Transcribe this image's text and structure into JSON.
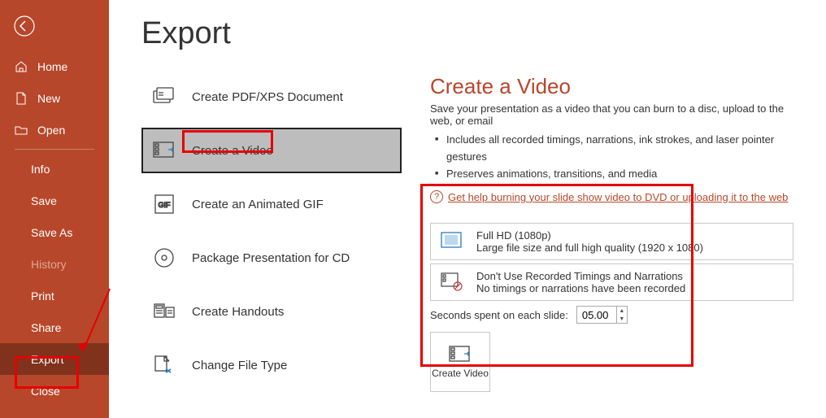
{
  "sidebar": {
    "home": "Home",
    "new": "New",
    "open": "Open",
    "info": "Info",
    "save": "Save",
    "save_as": "Save As",
    "history": "History",
    "print": "Print",
    "share": "Share",
    "export": "Export",
    "close": "Close"
  },
  "page": {
    "title": "Export"
  },
  "export_items": {
    "pdf": "Create PDF/XPS Document",
    "video": "Create a Video",
    "gif": "Create an Animated GIF",
    "package": "Package Presentation for CD",
    "handouts": "Create Handouts",
    "change_type": "Change File Type"
  },
  "detail": {
    "title": "Create a Video",
    "desc": "Save your presentation as a video that you can burn to a disc, upload to the web, or email",
    "bullet1": "Includes all recorded timings, narrations, ink strokes, and laser pointer gestures",
    "bullet2": "Preserves animations, transitions, and media",
    "help": "Get help burning your slide show video to DVD or uploading it to the web",
    "quality": {
      "line1": "Full HD (1080p)",
      "line2": "Large file size and full high quality (1920 x 1080)"
    },
    "timings": {
      "line1": "Don't Use Recorded Timings and Narrations",
      "line2": "No timings or narrations have been recorded"
    },
    "seconds_label": "Seconds spent on each slide:",
    "seconds_value": "05.00",
    "create_video": "Create Video"
  }
}
